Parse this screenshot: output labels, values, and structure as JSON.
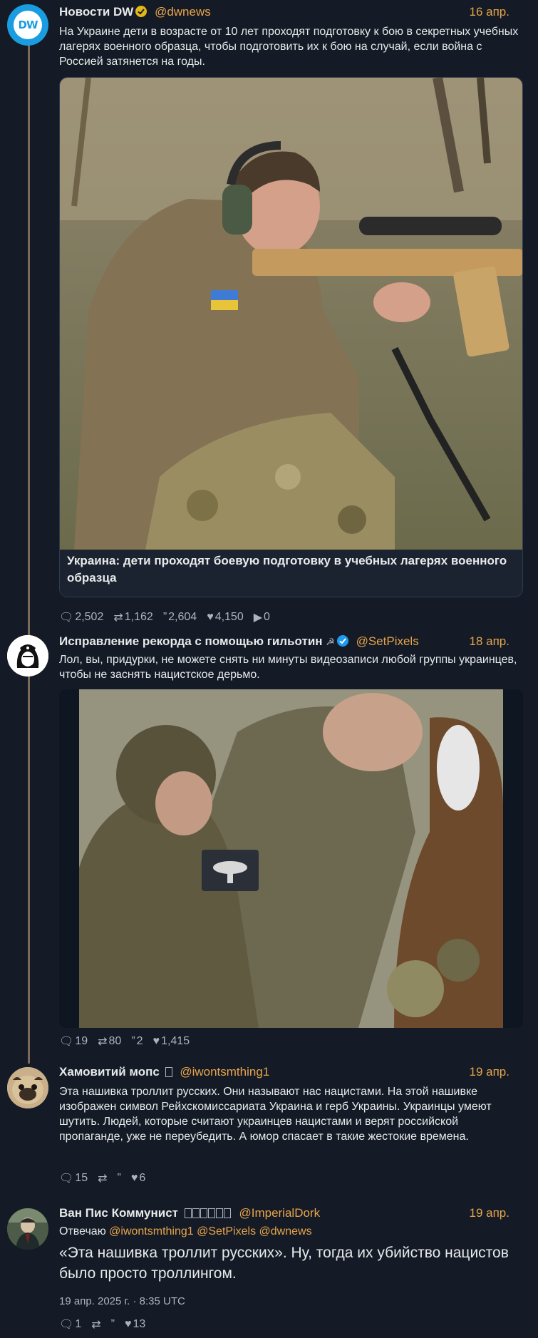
{
  "tweets": [
    {
      "name": "Новости DW",
      "handle": "@dwnews",
      "date": "16 апр.",
      "text": "На Украине дети в возрасте от 10 лет проходят подготовку к бою в секретных учебных лагерях военного образца, чтобы подготовить их к бою на случай, если война с Россией затянется на годы.",
      "avatar_text": "DW",
      "card_title": "Украина: дети проходят боевую подготовку в учебных лагерях военного образца",
      "replies": "2,502",
      "retweets": "1,162",
      "quotes": "2,604",
      "likes": "4,150",
      "views": "0"
    },
    {
      "name": "Исправление рекорда с помощью гильотин",
      "handle": "@SetPixels",
      "date": "18 апр.",
      "text": "Лол, вы, придурки, не можете снять ни минуты видеозаписи любой группы украинцев, чтобы не заснять нацистское дерьмо.",
      "replies": "19",
      "retweets": "80",
      "quotes": "2",
      "likes": "1,415"
    },
    {
      "name": "Хамовитий мопс",
      "name_suffix": "",
      "handle": "@iwontsmthing1",
      "date": "19 апр.",
      "text": "Эта нашивка троллит русских. Они называют нас нацистами. На этой нашивке изображен символ Рейхскомиссариата Украина и герб Украины. Украинцы умеют шутить. Людей, которые считают украинцев нацистами и верят российской пропаганде, уже не переубедить. А юмор спасает в такие жестокие времена.",
      "replies": "15",
      "retweets": "",
      "quotes": "",
      "likes": "6"
    },
    {
      "name": "Ван Пис Коммунист",
      "name_suffix": "",
      "handle": "@ImperialDork",
      "date": "19 апр.",
      "reply_prefix": "Отвечаю",
      "reply_to": [
        "@iwontsmthing1",
        "@SetPixels",
        "@dwnews"
      ],
      "text": "«Эта нашивка троллит русских». Ну, тогда их убийство нацистов было просто троллингом.",
      "timestamp": "19 апр. 2025 г. · 8:35 UTC",
      "replies": "1",
      "retweets": "",
      "quotes": "",
      "likes": "13"
    }
  ],
  "icons": {
    "reply": "reply-icon",
    "retweet": "retweet-icon",
    "quote": "quote-icon",
    "like": "heart-icon",
    "views": "play-icon"
  },
  "colors": {
    "background": "#141b26",
    "accent": "#e8a44a",
    "thread_line": "#7b6a56",
    "muted": "#aab4bf",
    "verified": "#1d9bf0",
    "gold_badge": "#e2b719"
  }
}
